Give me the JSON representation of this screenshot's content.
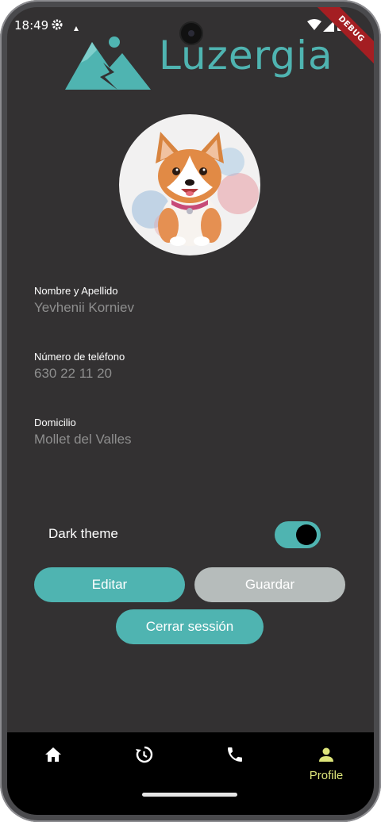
{
  "status_bar": {
    "time": "18:49",
    "icons": [
      "gear-icon",
      "notification-icon",
      "wifi-icon",
      "signal-icon",
      "battery-icon"
    ]
  },
  "debug_banner": "DEBUG",
  "app": {
    "logo_text": "Luzergia",
    "brand_color": "#4fb4b1"
  },
  "profile": {
    "fields": [
      {
        "label": "Nombre y Apellido",
        "value": "Yevhenii Korniev"
      },
      {
        "label": "Número de teléfono",
        "value": "630 22 11 20"
      },
      {
        "label": "Domicilio",
        "value": "Mollet del Valles"
      }
    ],
    "dark_theme_label": "Dark theme",
    "dark_theme_on": true,
    "edit_label": "Editar",
    "save_label": "Guardar",
    "logout_label": "Cerrar sessión"
  },
  "bottom_nav": {
    "items": [
      {
        "icon": "home-icon",
        "label": ""
      },
      {
        "icon": "history-icon",
        "label": ""
      },
      {
        "icon": "phone-icon",
        "label": ""
      },
      {
        "icon": "person-icon",
        "label": "Profile"
      }
    ],
    "active_color": "#dde57a"
  }
}
